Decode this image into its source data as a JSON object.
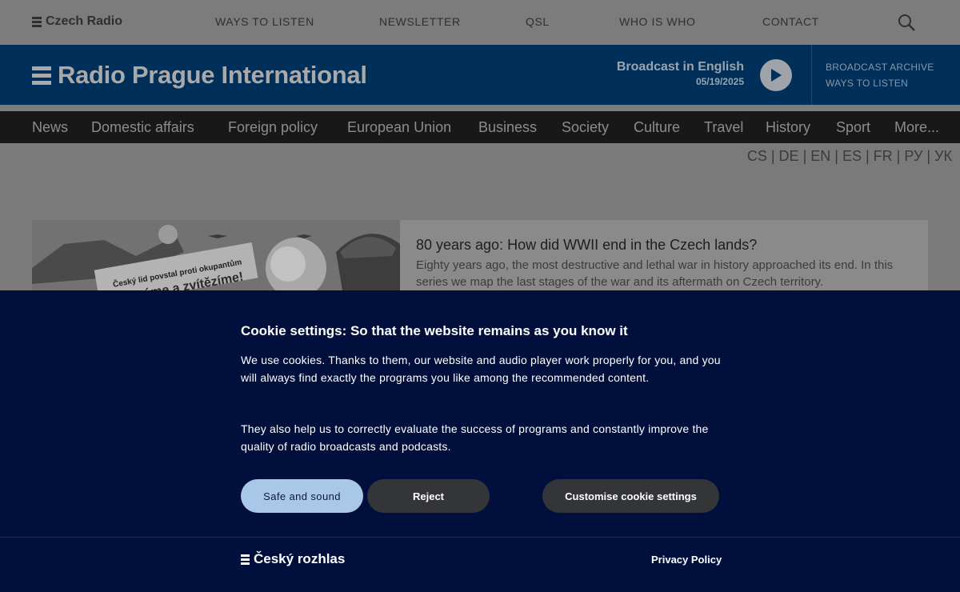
{
  "topbar": {
    "logo": "Czech Radio",
    "nav": [
      "WAYS TO LISTEN",
      "NEWSLETTER",
      "QSL",
      "WHO IS WHO",
      "CONTACT"
    ],
    "search_icon": "search-icon"
  },
  "header": {
    "logo": "Radio Prague International",
    "broadcast_title": "Broadcast in English",
    "broadcast_date": "05/19/2025",
    "side_links": [
      "BROADCAST ARCHIVE",
      "WAYS TO LISTEN"
    ]
  },
  "sections": [
    "News",
    "Domestic affairs",
    "Foreign policy",
    "European Union",
    "Business",
    "Society",
    "Culture",
    "Travel",
    "History",
    "Sport",
    "More..."
  ],
  "languages": [
    "CS",
    "DE",
    "EN",
    "ES",
    "FR",
    "РУ",
    "УК"
  ],
  "article": {
    "title": "80 years ago: How did WWII end in the Czech lands?",
    "summary": "Eighty years ago, the most destructive and lethal war in history approached its end. In this series we map the last stages of the war and its aftermath on Czech territory.",
    "image_caption_1": "Český lid povstal proti okupantům",
    "image_caption_2": "Vydrváme a zvítězíme!"
  },
  "cookie": {
    "title": "Cookie settings: So that the website remains as you know it",
    "paragraph1": "We use cookies. Thanks to them, our website and audio player work properly for you, and you will always find exactly the programs you like among the recommended content.",
    "paragraph2": "They also help us to correctly evaluate the success of programs and constantly improve the quality of radio broadcasts and podcasts.",
    "btn_safe": "Safe and sound",
    "btn_reject": "Reject",
    "btn_customise": "Customise cookie settings",
    "footer_logo": "Český rozhlas",
    "privacy": "Privacy Policy"
  }
}
